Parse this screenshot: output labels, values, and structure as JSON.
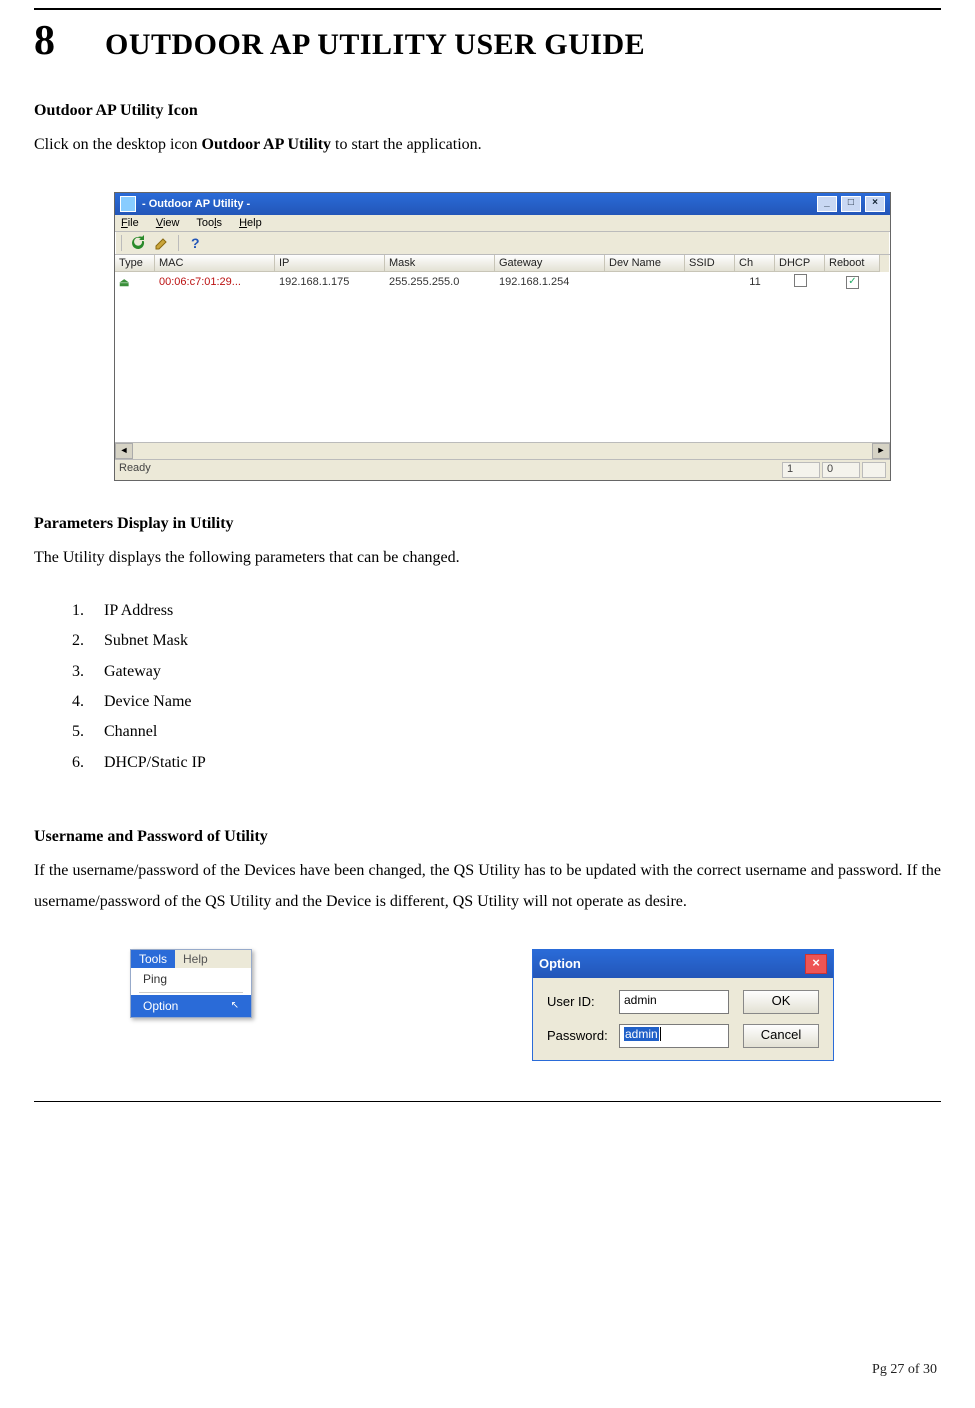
{
  "chapter": {
    "number": "8",
    "title": "OUTDOOR AP UTILITY USER GUIDE"
  },
  "section1": {
    "heading": "Outdoor AP Utility Icon",
    "text_prefix": "Click on the desktop icon ",
    "text_bold": "Outdoor AP Utility",
    "text_suffix": " to start the application."
  },
  "main_window": {
    "title": "- Outdoor AP Utility -",
    "menus": {
      "file": "File",
      "view": "View",
      "tools": "Tools",
      "help": "Help"
    },
    "headers": {
      "type": "Type",
      "mac": "MAC",
      "ip": "IP",
      "mask": "Mask",
      "gateway": "Gateway",
      "devname": "Dev Name",
      "ssid": "SSID",
      "ch": "Ch",
      "dhcp": "DHCP",
      "reboot": "Reboot"
    },
    "row": {
      "mac": "00:06:c7:01:29...",
      "ip": "192.168.1.175",
      "mask": "255.255.255.0",
      "gateway": "192.168.1.254",
      "devname": "",
      "ssid": "",
      "ch": "11"
    },
    "status": {
      "ready": "Ready",
      "pane1": "1",
      "pane2": "0"
    }
  },
  "section2": {
    "heading": "Parameters Display in Utility",
    "text": "The Utility displays the following parameters that can be changed.",
    "items": [
      "IP Address",
      "Subnet Mask",
      "Gateway",
      "Device Name",
      "Channel",
      "DHCP/Static IP"
    ]
  },
  "section3": {
    "heading": "Username and Password of Utility",
    "text": "If the username/password of the Devices have been changed, the QS Utility has to be updated with the correct username and password. If the username/password of the QS Utility and the Device is different, QS Utility will not operate as desire."
  },
  "tools_menu": {
    "tab_active": "Tools",
    "tab_other": "Help",
    "item_ping": "Ping",
    "item_option": "Option"
  },
  "option_dialog": {
    "title": "Option",
    "userid_label": "User ID:",
    "userid_value": "admin",
    "password_label": "Password:",
    "password_value": "admin",
    "ok": "OK",
    "cancel": "Cancel"
  },
  "footer": {
    "text": "Pg 27 of 30"
  }
}
